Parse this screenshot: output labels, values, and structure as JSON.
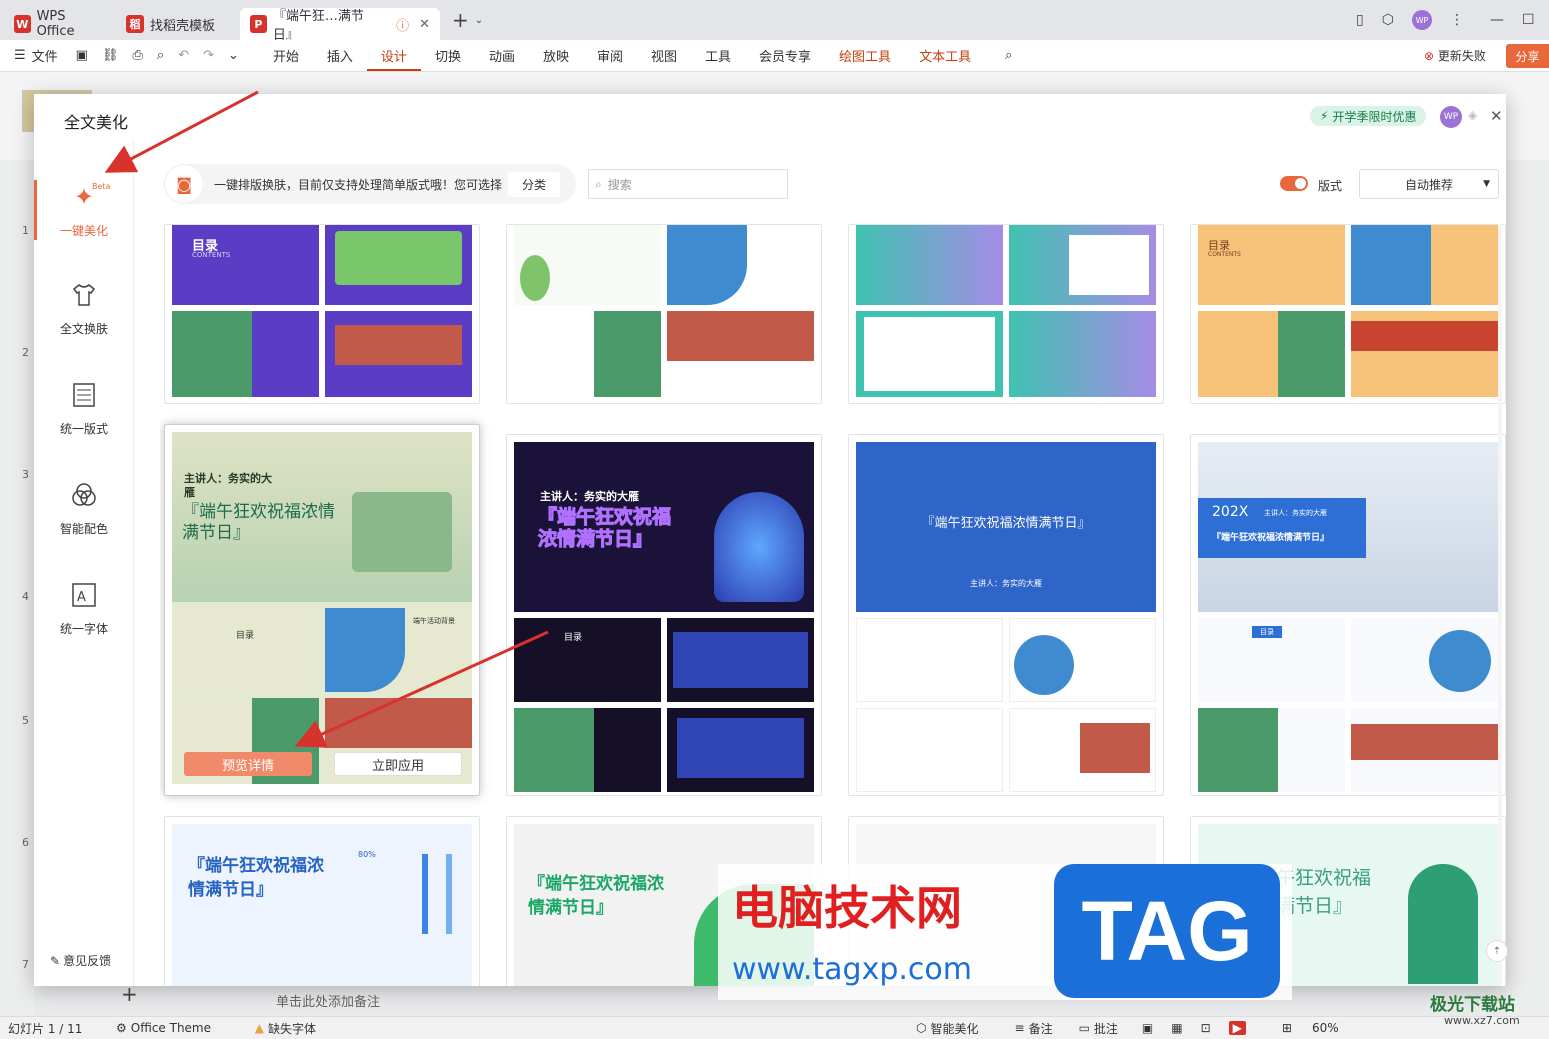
{
  "tabs": [
    {
      "label": "WPS Office",
      "icon": "wps-logo-icon"
    },
    {
      "label": "找稻壳模板",
      "icon": "docer-icon"
    },
    {
      "label": "『端午狂…满节日』",
      "icon": "ppt-file-icon"
    }
  ],
  "menu": {
    "file": "文件",
    "items": [
      "开始",
      "插入",
      "设计",
      "切换",
      "动画",
      "放映",
      "审阅",
      "视图",
      "工具",
      "会员专享",
      "绘图工具",
      "文本工具"
    ],
    "active": "设计",
    "update_label": "更新失败",
    "share_label": "分享"
  },
  "dialog": {
    "title": "全文美化",
    "promo_badge": "开学季限时优惠",
    "avatar_text": "WP",
    "sidebar": [
      {
        "label": "一键美化",
        "icon": "magic-wand-icon",
        "badge": "Beta"
      },
      {
        "label": "全文换肤",
        "icon": "tshirt-icon"
      },
      {
        "label": "统一版式",
        "icon": "layout-icon"
      },
      {
        "label": "智能配色",
        "icon": "color-circles-icon"
      },
      {
        "label": "统一字体",
        "icon": "font-icon"
      }
    ],
    "feedback": "意见反馈",
    "info_text": "一键排版换肤，目前仅支持处理简单版式哦！您可选择",
    "category_button": "分类",
    "search_placeholder": "搜索",
    "layout_toggle_label": "版式",
    "sort_select": "自动推荐",
    "card_buttons": {
      "preview": "预览详情",
      "apply": "立即应用"
    },
    "cards": {
      "r2c1": {
        "speaker": "主讲人：务实的大雁",
        "title": "『端午狂欢祝福浓情满节日』",
        "toc": "目录",
        "bg_title": "端午活动背景"
      },
      "r2c2": {
        "speaker": "主讲人：务实的大雁",
        "title": "『端午狂欢祝福浓情满节日』",
        "toc": "目录"
      },
      "r2c3": {
        "title": "『端午狂欢祝福浓情满节日』",
        "speaker": "主讲人：务实的大雁"
      },
      "r2c4": {
        "year": "202X",
        "speaker": "主讲人：务实的大雁",
        "title": "『端午狂欢祝福浓情满节日』",
        "toc": "目录"
      },
      "r1c1": {
        "toc": "目录",
        "contents": "CONTENTS"
      },
      "r1c4": {
        "toc": "目录",
        "contents": "CONTENTS"
      },
      "r3c1": {
        "title": "『端午狂欢祝福浓情满节日』",
        "percent": "80%"
      },
      "r3c2": {
        "title": "『端午狂欢祝福浓情满节日』"
      },
      "r3c4": {
        "title": "『端午狂欢祝福浓情满节日』"
      }
    }
  },
  "notes_placeholder": "单击此处添加备注",
  "status": {
    "slide": "幻灯片 1 / 11",
    "theme": "Office Theme",
    "missing_font": "缺失字体",
    "smart": "智能美化",
    "notes": "备注",
    "comments": "批注",
    "zoom": "60%"
  },
  "slide_numbers": [
    "1",
    "2",
    "3",
    "4",
    "5",
    "6",
    "7"
  ],
  "watermark": {
    "cn": "电脑技术网",
    "url": "www.tagxp.com",
    "tag": "TAG",
    "corner": "极光下载站",
    "corner_url": "www.xz7.com"
  },
  "colors": {
    "accent": "#e8683b",
    "wps_red": "#d8322d",
    "blue_tag": "#1b6fd9"
  }
}
